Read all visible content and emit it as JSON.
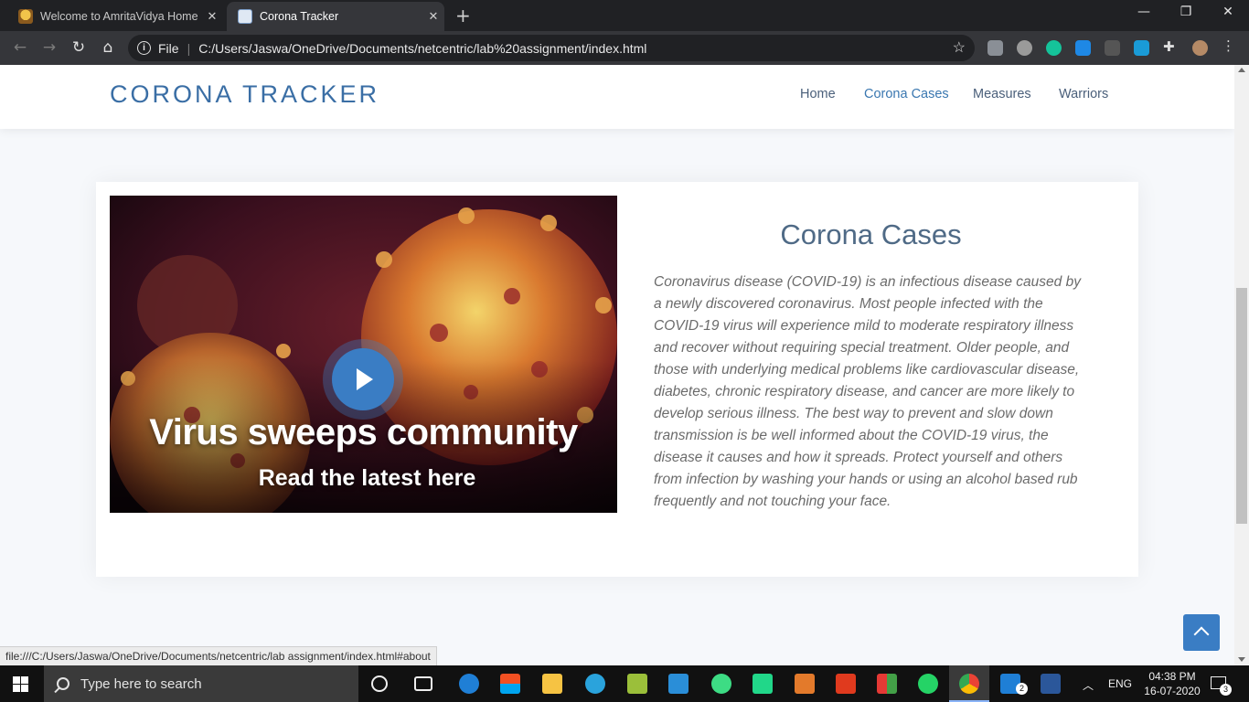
{
  "browser": {
    "tabs": [
      {
        "title": "Welcome to AmritaVidya Home",
        "icon": "amrita-favicon-icon"
      },
      {
        "title": "Corona Tracker",
        "icon": "corona-tracker-favicon-icon"
      }
    ],
    "address": {
      "scheme_label": "File",
      "url": "C:/Users/Jaswa/OneDrive/Documents/netcentric/lab%20assignment/index.html"
    },
    "status_url": "file:///C:/Users/Jaswa/OneDrive/Documents/netcentric/lab assignment/index.html#about"
  },
  "site": {
    "logo": "CORONA TRACKER",
    "nav": [
      "Home",
      "Corona Cases",
      "Measures",
      "Warriors"
    ],
    "active_nav": "Corona Cases"
  },
  "about": {
    "video_headline": "Virus sweeps community",
    "video_subline": "Read the latest here",
    "title": "Corona Cases",
    "body": "Coronavirus disease (COVID-19) is an infectious disease caused by a newly discovered coronavirus. Most people infected with the COVID-19 virus will experience mild to moderate respiratory illness and recover without requiring special treatment. Older people, and those with underlying medical problems like cardiovascular disease, diabetes, chronic respiratory disease, and cancer are more likely to develop serious illness. The best way to prevent and slow down transmission is be well informed about the COVID-19 virus, the disease it causes and how it spreads. Protect yourself and others from infection by washing your hands or using an alcohol based rub frequently and not touching your face."
  },
  "taskbar": {
    "search_placeholder": "Type here to search",
    "mail_badge": "2",
    "notification_badge": "3",
    "language": "ENG",
    "time": "04:38 PM",
    "date": "16-07-2020"
  },
  "colors": {
    "accent": "#3a7dc4",
    "logo": "#3a6ea5",
    "heading": "#4f6a86"
  }
}
